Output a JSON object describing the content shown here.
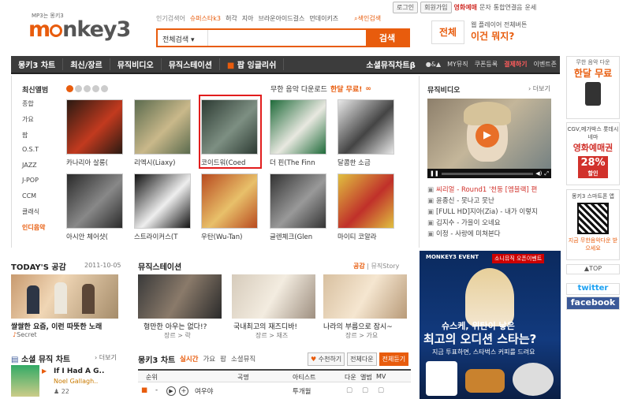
{
  "top_links": {
    "login": "로그인",
    "signup": "회원가입",
    "movie": "영화예매",
    "message": "문자",
    "integrated": "통합연결음",
    "fortune": "운세"
  },
  "logo": {
    "tagline": "MP3는 몽키3",
    "text_a": "m",
    "text_b": "nkey3"
  },
  "search": {
    "popular_label": "인기검색어",
    "tags": [
      "슈퍼스타k3",
      "허각",
      "지아",
      "브라운아이드걸스",
      "먼데이키즈"
    ],
    "advanced": "색인검색",
    "select": "전체검색",
    "placeholder": "",
    "button": "검색"
  },
  "promo_top": {
    "badge": "전체",
    "line1": "웹 플레이어 전체버튼",
    "line2": "이건 뭐지?"
  },
  "nav": {
    "items": [
      "몽키3 차트",
      "최신/장르",
      "뮤직비디오",
      "뮤직스테이션",
      "팝 잉글리쉬"
    ],
    "social": "소셜뮤직차트β",
    "right": [
      "MY뮤직",
      "쿠폰등록",
      "결제하기",
      "이벤트존"
    ]
  },
  "albums": {
    "category_title": "최신앨범",
    "categories": [
      "종합",
      "가요",
      "팝",
      "O.S.T",
      "JAZZ",
      "J-POP",
      "CCM",
      "클래식",
      "인디음악"
    ],
    "free_download": "무한 음악 다운로드",
    "free_highlight": "한달 무료!",
    "items": [
      {
        "title": "카나리아 살롱(",
        "color1": "#2a1a12",
        "color2": "#c23a1f"
      },
      {
        "title": "리엑시(Liaxy)",
        "color1": "#5b6b4e",
        "color2": "#c9b88a"
      },
      {
        "title": "코이드워(Coed",
        "color1": "#2d3b33",
        "color2": "#7d8f82"
      },
      {
        "title": "더 핀(The Finn",
        "color1": "#1f6b3a",
        "color2": "#e8e8e0"
      },
      {
        "title": "달콤한 소금",
        "color1": "#e8e8e8",
        "color2": "#444444"
      },
      {
        "title": "아시안 체어샷(",
        "color1": "#2a2a2a",
        "color2": "#888888"
      },
      {
        "title": "스트라이커스(T",
        "color1": "#111111",
        "color2": "#eeeeee"
      },
      {
        "title": "우탄(Wu-Tan)",
        "color1": "#b84a1f",
        "color2": "#e8c06a"
      },
      {
        "title": "글렌체크(Glen",
        "color1": "#333333",
        "color2": "#999999"
      },
      {
        "title": "마이티 코알라",
        "color1": "#e0c040",
        "color2": "#c0302a"
      }
    ]
  },
  "video": {
    "title": "뮤직비디오",
    "more": "더보기",
    "items": [
      "씨리얼 - Round1 '천둥 [엠블랙] 편",
      "윤종신 - 못나고 못난",
      "[FULL HD]지아(Zia) - 내가 이렇지",
      "김지수 - 가을이 오네요",
      "이정 - 사랑에 미쳐본다"
    ]
  },
  "side": {
    "ad1_small": "무한 음악 다운",
    "ad1_big": "한달 무료",
    "ad2_small": "CGV,메가박스 롯데시네마",
    "ad2_big": "영화예매권",
    "ad2_pct": "28%",
    "ad2_tail": "할인",
    "qr_title": "몽키3 스마트폰 앱",
    "qr_caption": "지금 무한음악다운 받으세요",
    "top": "TOP",
    "twitter": "twitter",
    "facebook": "facebook"
  },
  "today": {
    "title": "TODAY'S 공감",
    "date": "2011-10-05",
    "caption": "쌀쌀한 요즘, 이런 따뜻한 노래",
    "tag": "Secret"
  },
  "social_chart": {
    "title": "소셜 뮤직 차트",
    "more": "더보기",
    "song": "If I Had A G..",
    "artist": "Noel Gallagh..",
    "count": "22"
  },
  "station": {
    "title": "뮤직스테이션",
    "tab_on": "공감",
    "tab_off": "뮤직Story",
    "items": [
      {
        "caption": "형만한 아우는 없다!?",
        "sub": "장르 > 락"
      },
      {
        "caption": "국내최고의 재즈디바!",
        "sub": "장르 > 재즈"
      },
      {
        "caption": "나라의 부름으로 잠시~",
        "sub": "장르 > 가요"
      }
    ]
  },
  "chart": {
    "title": "몽키3 차트",
    "tabs": [
      "실시간",
      "가요",
      "팝",
      "소셜뮤직"
    ],
    "buttons": [
      "수천하기",
      "전체다운",
      "전체듣기"
    ],
    "head": {
      "rank": "순위",
      "song": "곡명",
      "artist": "아티스트",
      "down": "다운",
      "album": "앨범",
      "mv": "MV"
    },
    "row": {
      "artist_short": "여우야",
      "artist": "투개월"
    }
  },
  "event": {
    "head": "MONKEY3 EVENT",
    "tag": "소니뮤직 오픈이벤트",
    "line1": "슈스케, 위탄이 낳은",
    "line2": "최고의 오디션 스타는?",
    "line3": "지금 투표하면, 스타벅스 커피를 드려요"
  }
}
